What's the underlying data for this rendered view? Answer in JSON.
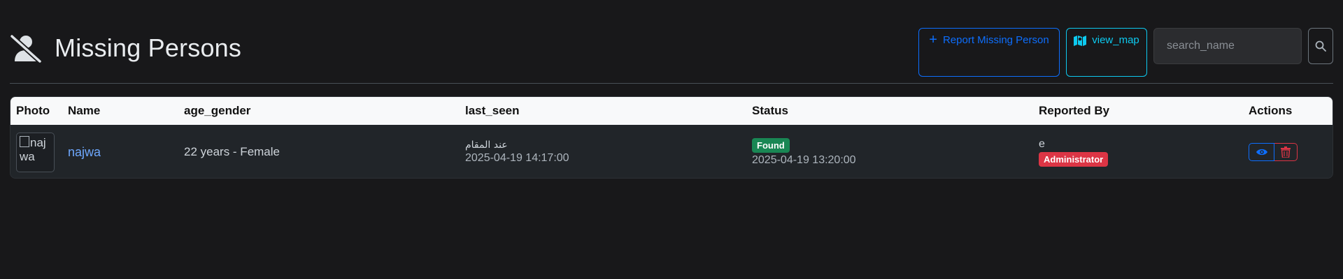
{
  "header": {
    "title": "Missing Persons",
    "title_icon": "user-slash-icon",
    "report_button_label": "Report Missing Person",
    "view_map_label": "view_map",
    "search_placeholder": "search_name",
    "search_icon": "search-icon"
  },
  "colors": {
    "background": "#18181a",
    "primary": "#0d6efd",
    "info": "#0dcaf0",
    "success": "#198754",
    "danger": "#dc3545"
  },
  "table": {
    "columns": [
      "Photo",
      "Name",
      "age_gender",
      "last_seen",
      "Status",
      "Reported By",
      "Actions"
    ],
    "rows": [
      {
        "photo_alt": "najwa",
        "name": "najwa",
        "age_gender": "22 years - Female",
        "last_seen_location": "عند المقام",
        "last_seen_time": "2025-04-19 14:17:00",
        "status": "Found",
        "status_time": "2025-04-19 13:20:00",
        "reported_by": "e",
        "reporter_role": "Administrator"
      }
    ]
  }
}
